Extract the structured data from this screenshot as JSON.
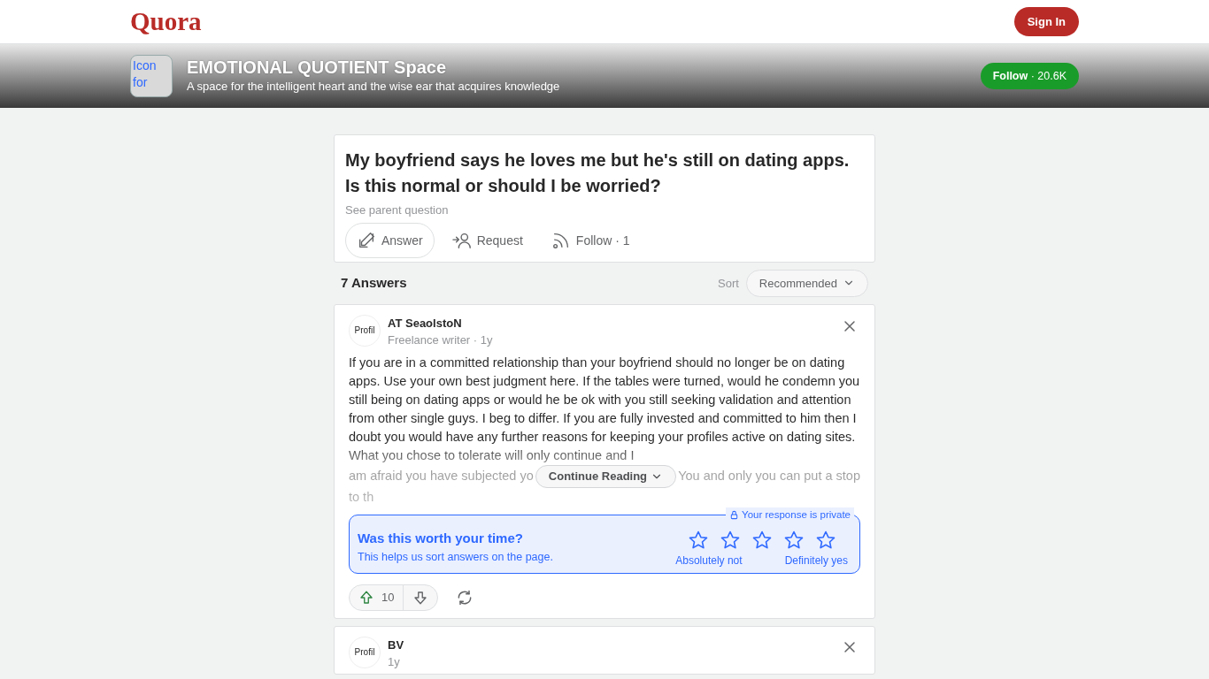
{
  "site": {
    "logo": "Quora",
    "sign_in": "Sign In"
  },
  "space": {
    "icon_alt": "Icon for",
    "name": "EMOTIONAL QUOTIENT Space",
    "tagline": "A space for the intelligent heart and the wise ear that acquires knowledge",
    "follow": "**Follow** · 20.6K"
  },
  "question": {
    "title": "My boyfriend says he loves me but he's still on dating apps. Is this normal or should I be worried?",
    "parent_link": "See parent question",
    "actions": [
      {
        "kind": "answer",
        "label": "Answer"
      },
      {
        "kind": "request",
        "label": "Request"
      },
      {
        "kind": "follow",
        "label": "Follow · 1"
      }
    ]
  },
  "answers_header": {
    "count": "7 Answers",
    "sort_label": "Sort",
    "sort_value": "Recommended"
  },
  "answers": [
    {
      "avatar_alt": "Profil",
      "author": "AT SeaolstoN",
      "meta": "Freelance writer · 1y",
      "text": "If you are in a committed relationship than your boyfriend should no longer be on dating apps. Use your own best judgment here. If the tables were turned, would he condemn you still being on dating apps or would he be ok with you still seeking validation and attention from other single guys. I beg to differ. If you are fully invested and committed to him then I doubt you would have any further reasons for keeping your profiles active on dating sites. What you chose to tolerate will only continue and I",
      "text_left": "am afraid you have subjected yo",
      "continue": "Continue Reading",
      "text_right": "You and only you can put a stop",
      "text_tail": "to th",
      "rating": {
        "question": "Was this worth your time?",
        "hint": "This helps us sort answers on the page.",
        "privacy": "Your response is private",
        "stars": 0,
        "low_label": "Absolutely not",
        "high_label": "Definitely yes"
      },
      "upvotes": "10"
    },
    {
      "avatar_alt": "Profil",
      "author": "BV",
      "meta": "1y"
    }
  ]
}
